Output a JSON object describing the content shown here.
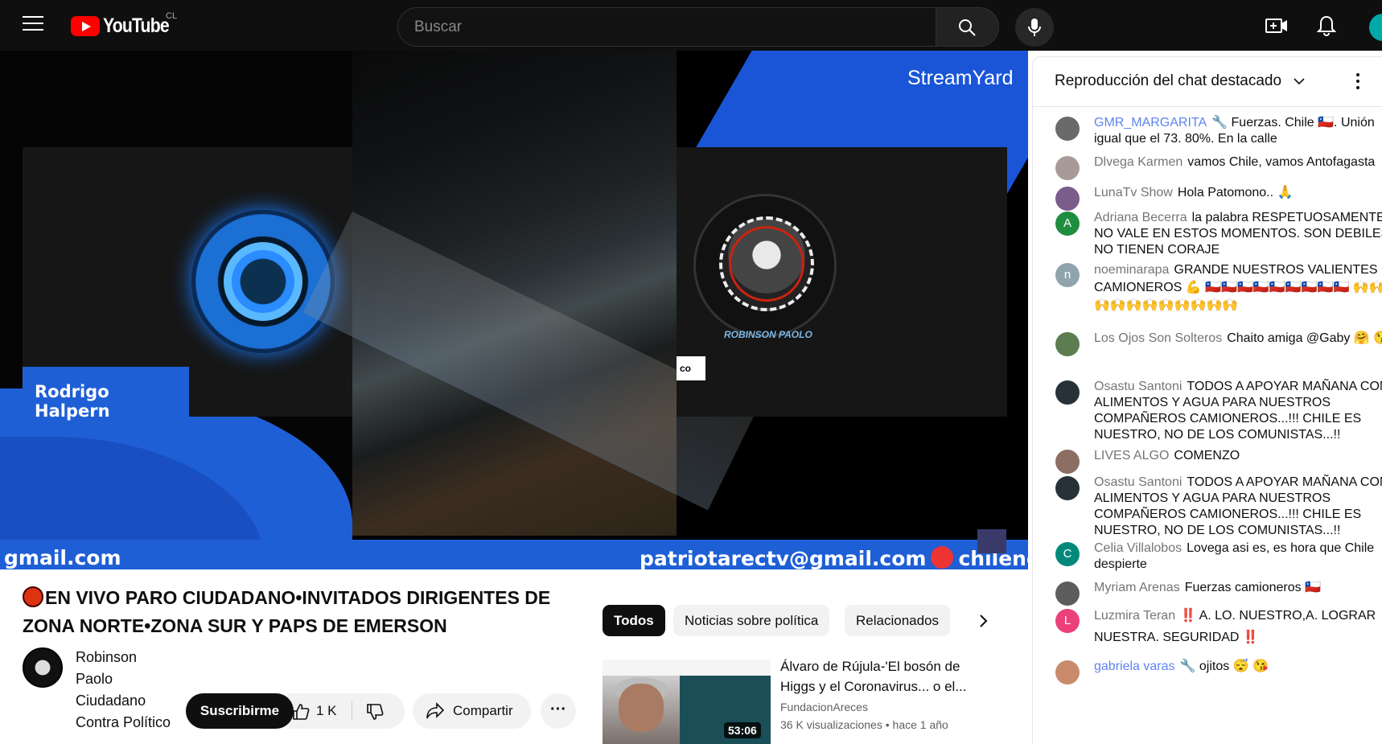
{
  "header": {
    "logo_text": "YouTube",
    "country_code": "CL",
    "search_placeholder": "Buscar"
  },
  "player": {
    "guest_left_name": "Rodrigo Halpern",
    "guest_right_overlay": "ROBINSON PAOLO",
    "co_tag": "co",
    "streamyard_brand": "StreamYard",
    "banner_left": "gmail.com",
    "banner_right_email": "patriotarectv@gmail.com",
    "banner_right_tail": "chilenos"
  },
  "video": {
    "title": "EN VIVO PARO CIUDADANO•INVITADOS DIRIGENTES DE ZONA NORTE•ZONA SUR Y PAPS DE EMERSON",
    "channel_name": "Robinson Paolo Ciudadano Contra Político",
    "subscribe_label": "Suscribirme",
    "like_count": "1 K",
    "share_label": "Compartir",
    "more_label": "···"
  },
  "chips": [
    {
      "label": "Todos",
      "active": true
    },
    {
      "label": "Noticias sobre política",
      "active": false
    },
    {
      "label": "Relacionados",
      "active": false
    }
  ],
  "related": {
    "title": "Álvaro de Rújula-'El bosón de Higgs y el Coronavirus... o el...",
    "channel": "FundacionAreces",
    "views": "36 K visualizaciones",
    "age": "hace 1 año",
    "duration": "53:06"
  },
  "chat": {
    "title": "Reproducción del chat destacado",
    "messages": [
      {
        "author": "GMR_MARGARITA",
        "moderator": true,
        "text": "Fuerzas. Chile 🇨🇱. Unión igual que el 73. 80%. En la calle",
        "avatar_color": "#6a6a6a",
        "avatar_letter": ""
      },
      {
        "author": "Dlvega Karmen",
        "moderator": false,
        "text": "vamos Chile, vamos Antofagasta",
        "avatar_color": "#a99a9a",
        "avatar_letter": ""
      },
      {
        "author": "LunaTv Show",
        "moderator": false,
        "text": "Hola Patomono.. 🙏",
        "avatar_color": "#7a5d8a",
        "avatar_letter": ""
      },
      {
        "author": "Adriana Becerra",
        "moderator": false,
        "text": "la palabra RESPETUOSAMENTE NO VALE EN ESTOS MOMENTOS. SON DEBILES NO TIENEN CORAJE",
        "avatar_color": "#1e8e3e",
        "avatar_letter": "A"
      },
      {
        "author": "noeminarapa",
        "moderator": false,
        "text": "GRANDE NUESTROS VALIENTES CAMIONEROS 💪 🇨🇱🇨🇱🇨🇱🇨🇱🇨🇱🇨🇱🇨🇱🇨🇱🇨🇱 🙌🙌🙌🙌🙌🙌🙌🙌🙌🙌🙌",
        "avatar_color": "#90a4ae",
        "avatar_letter": "n"
      },
      {
        "author": "Los Ojos Son Solteros",
        "moderator": false,
        "text": "Chaito amiga @Gaby 🤗 😘",
        "avatar_color": "#5b7d4f",
        "avatar_letter": ""
      },
      {
        "author": "Osastu Santoni",
        "moderator": false,
        "text": "TODOS A APOYAR MAÑANA CON ALIMENTOS Y AGUA PARA NUESTROS COMPAÑEROS CAMIONEROS...!!! CHILE ES NUESTRO, NO DE LOS COMUNISTAS...!!",
        "avatar_color": "#263238",
        "avatar_letter": ""
      },
      {
        "author": "LIVES ALGO",
        "moderator": false,
        "text": "COMENZO",
        "avatar_color": "#8d6e63",
        "avatar_letter": ""
      },
      {
        "author": "Osastu Santoni",
        "moderator": false,
        "text": "TODOS A APOYAR MAÑANA CON ALIMENTOS Y AGUA PARA NUESTROS COMPAÑEROS CAMIONEROS...!!! CHILE ES NUESTRO, NO DE LOS COMUNISTAS...!!",
        "avatar_color": "#263238",
        "avatar_letter": ""
      },
      {
        "author": "Celia Villalobos",
        "moderator": false,
        "text": "Lovega asi es, es hora que Chile despierte",
        "avatar_color": "#00897b",
        "avatar_letter": "C"
      },
      {
        "author": "Myriam Arenas",
        "moderator": false,
        "text": "Fuerzas camioneros 🇨🇱",
        "avatar_color": "#5d5d5d",
        "avatar_letter": ""
      },
      {
        "author": "Luzmira Teran",
        "moderator": false,
        "text": "‼️ A. LO. NUESTRO,A. LOGRAR NUESTRA. SEGURIDAD ‼️",
        "avatar_color": "#ec407a",
        "avatar_letter": "L"
      },
      {
        "author": "gabriela varas",
        "moderator": true,
        "text": "ojitos 😴 😘",
        "avatar_color": "#c98b6b",
        "avatar_letter": ""
      }
    ]
  }
}
